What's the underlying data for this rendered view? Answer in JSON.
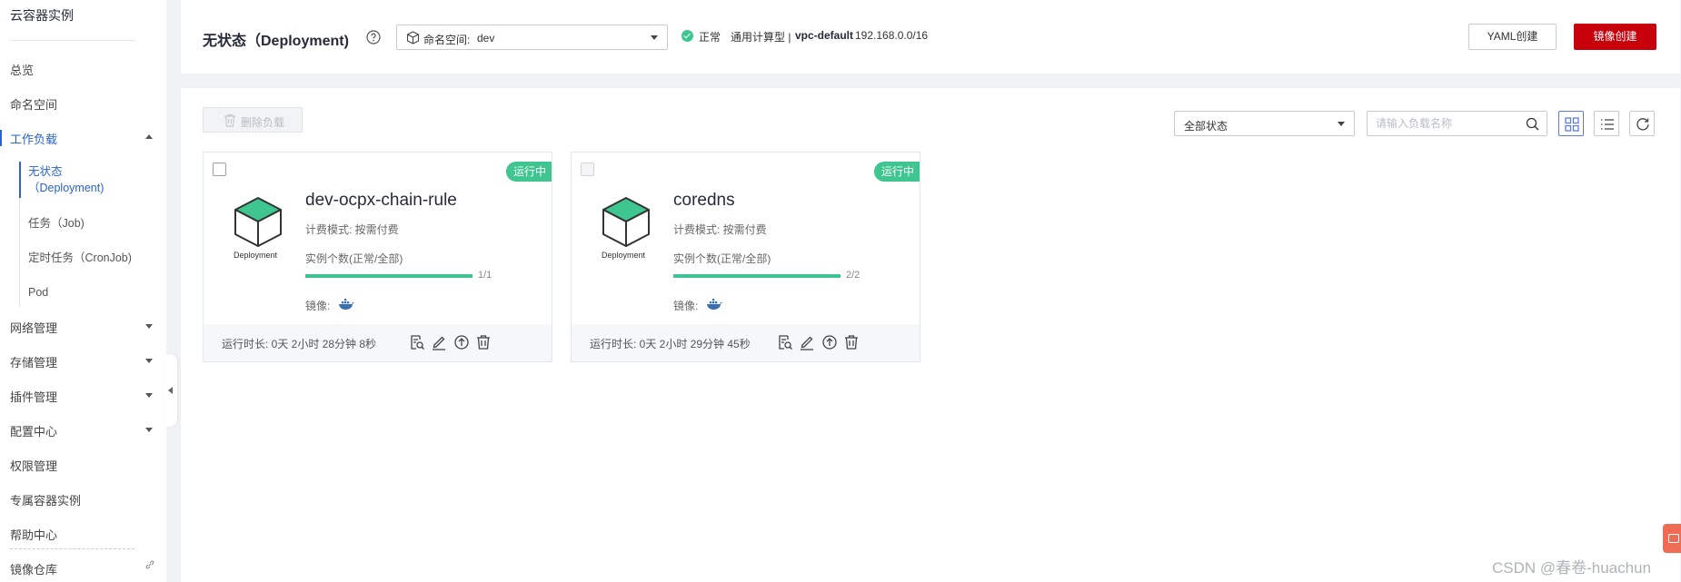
{
  "sidebar": {
    "title": "云容器实例",
    "items": [
      {
        "label": "总览"
      },
      {
        "label": "命名空间"
      },
      {
        "label": "工作负载"
      },
      {
        "label": "网络管理"
      },
      {
        "label": "存储管理"
      },
      {
        "label": "插件管理"
      },
      {
        "label": "配置中心"
      },
      {
        "label": "权限管理"
      },
      {
        "label": "专属容器实例"
      },
      {
        "label": "帮助中心"
      },
      {
        "label": "镜像仓库"
      }
    ],
    "sub_items": [
      {
        "label_line1": "无状态",
        "label_line2": "（Deployment)"
      },
      {
        "label": "任务（Job)"
      },
      {
        "label": "定时任务（CronJob)"
      },
      {
        "label": "Pod"
      }
    ]
  },
  "header": {
    "title": "无状态（Deployment)",
    "namespace_label": "命名空间:",
    "namespace_value": "dev",
    "status": "正常",
    "compute_type": "通用计算型 |",
    "vpc_name": "vpc-default",
    "vpc_cidr": "192.168.0.0/16",
    "yaml_button": "YAML创建",
    "image_button": "镜像创建"
  },
  "toolbar": {
    "delete_button": "删除负载",
    "status_filter": "全部状态",
    "search_placeholder": "请输入负载名称"
  },
  "cards": [
    {
      "name": "dev-ocpx-chain-rule",
      "status_badge": "运行中",
      "icon_label": "Deployment",
      "billing": "计费模式: 按需付费",
      "instance_label": "实例个数(正常/全部)",
      "instance_count": "1/1",
      "instance_ratio": 1.0,
      "image_label": "镜像:",
      "runtime": "运行时长: 0天 2小时 28分钟 8秒"
    },
    {
      "name": "coredns",
      "status_badge": "运行中",
      "icon_label": "Deployment",
      "billing": "计费模式: 按需付费",
      "instance_label": "实例个数(正常/全部)",
      "instance_count": "2/2",
      "instance_ratio": 1.0,
      "image_label": "镜像:",
      "runtime": "运行时长: 0天 2小时 29分钟 45秒"
    }
  ],
  "watermark": "CSDN @春卷-huachun",
  "colors": {
    "accent": "#2a64c8",
    "primary_button": "#c7000b",
    "running": "#3fc58f",
    "deployment_icon": "#3fc58f"
  }
}
